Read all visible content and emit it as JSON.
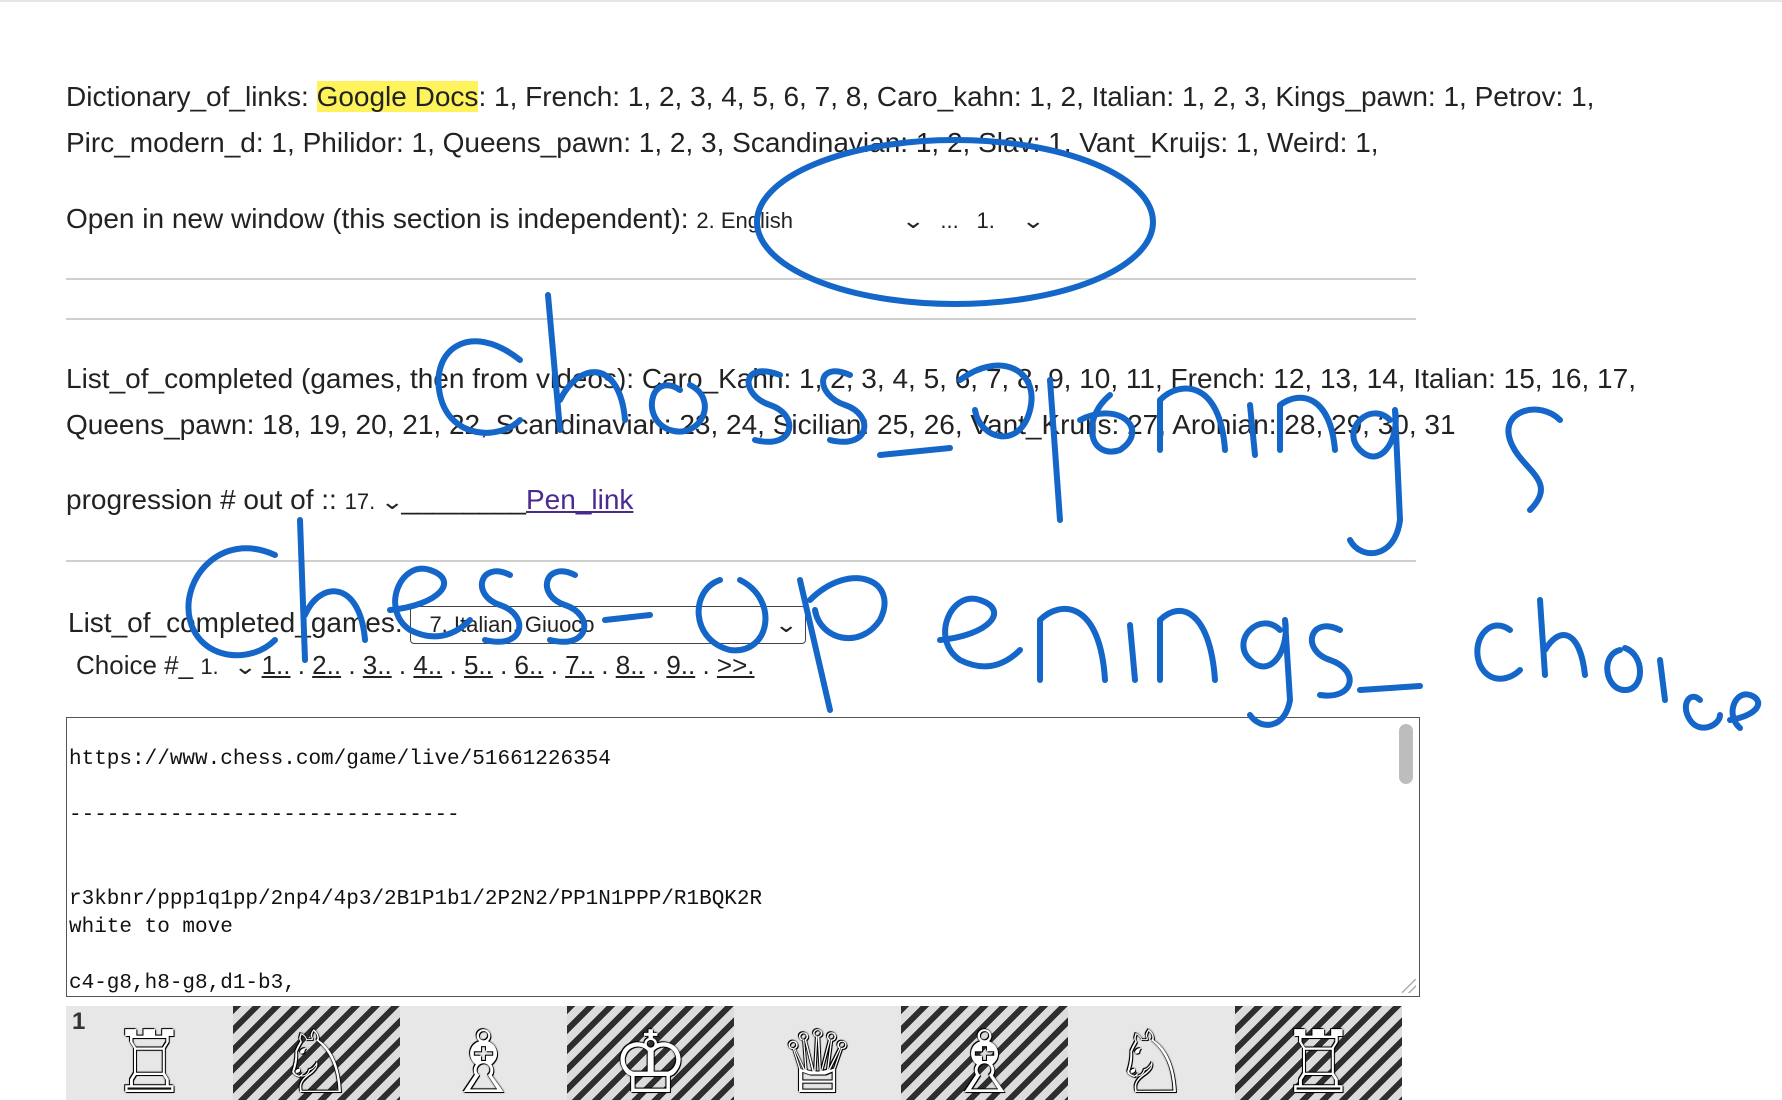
{
  "dictionary": {
    "label": "Dictionary_of_links:",
    "highlight": "Google Docs",
    "line1_rest": ": 1, French: 1, 2, 3, 4, 5, 6, 7, 8, Caro_kahn: 1, 2, Italian: 1, 2, 3, Kings_pawn: 1, Petrov: 1,",
    "line2": "Pirc_modern_d: 1, Philidor: 1, Queens_pawn: 1, 2, 3, Scandinavian: 1, 2, Slav: 1, Vant_Kruijs: 1, Weird: 1,"
  },
  "open_window": {
    "label": "Open in new window (this section is independent):",
    "select1_value": "2. English",
    "ellipsis": "...",
    "select2_value": "1."
  },
  "completed_list": {
    "line1": "List_of_completed (games, then from videos): Caro_Kahn: 1, 2, 3, 4, 5, 6, 7, 8, 9, 10, 11, French: 12, 13, 14, Italian: 15, 16, 17,",
    "line2": "Queens_pawn: 18, 19, 20, 21, 22, Scandinavian: 23, 24, Sicilian: 25, 26, Vant_Kruijs: 27, Aronian: 28, 29, 30, 31"
  },
  "progression": {
    "label": "progression # out of ::",
    "select_value": "17.",
    "blank": "________",
    "link": "Pen_link"
  },
  "games": {
    "label": "List_of_completed_games:",
    "select_value": "7. Italian, Giuoco",
    "choice_label": "Choice #_",
    "choice_value": "1.",
    "nav": [
      "1..",
      "2..",
      "3..",
      "4..",
      "5..",
      "6..",
      "7..",
      "8..",
      "9..",
      ">>."
    ]
  },
  "textarea": {
    "lines": [
      "https://www.chess.com/game/live/51661226354",
      "",
      "-------------------------------",
      "",
      "",
      "r3kbnr/ppp1q1pp/2np4/4p3/2B1P1b1/2P2N2/PP1N1PPP/R1BQK2R",
      "white to move",
      "",
      "c4-g8,h8-g8,d1-b3,"
    ]
  },
  "board": {
    "rank_label": "1",
    "pieces": [
      "rook-icon",
      "knight-icon",
      "bishop-icon",
      "king-icon",
      "queen-icon",
      "bishop-icon",
      "knight-icon",
      "rook-icon"
    ],
    "glyphs": [
      "♖",
      "♘",
      "♗",
      "♔",
      "♕",
      "♗",
      "♘",
      "♖"
    ]
  },
  "ink_color": "#1466c8"
}
